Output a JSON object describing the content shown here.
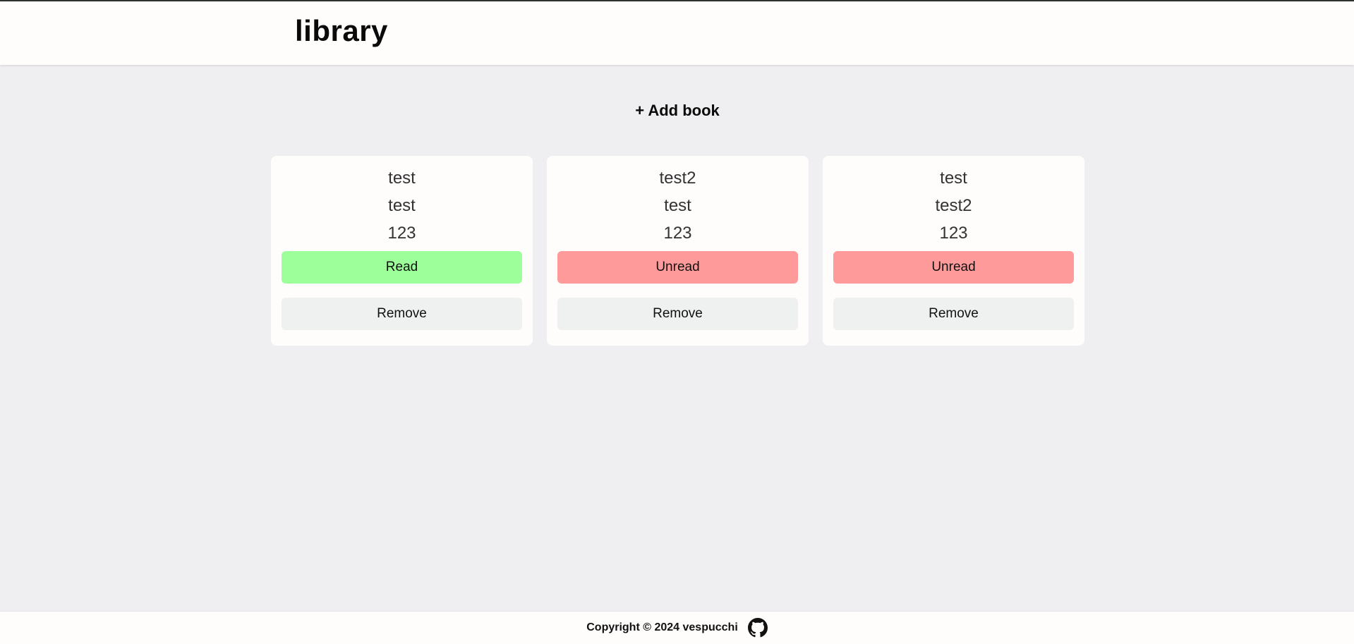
{
  "header": {
    "title": "library"
  },
  "actions": {
    "add_label": "+ Add book"
  },
  "books": [
    {
      "title": "test",
      "author": "test",
      "pages": "123",
      "status": "Read",
      "remove_label": "Remove"
    },
    {
      "title": "test2",
      "author": "test",
      "pages": "123",
      "status": "Unread",
      "remove_label": "Remove"
    },
    {
      "title": "test",
      "author": "test2",
      "pages": "123",
      "status": "Unread",
      "remove_label": "Remove"
    }
  ],
  "footer": {
    "copyright": "Copyright © 2024 vespucchi",
    "icon": "github-icon"
  },
  "colors": {
    "read": "#9dff9a",
    "unread": "#ff9a9b",
    "background": "#efeff1",
    "surface": "#fffcfc"
  }
}
